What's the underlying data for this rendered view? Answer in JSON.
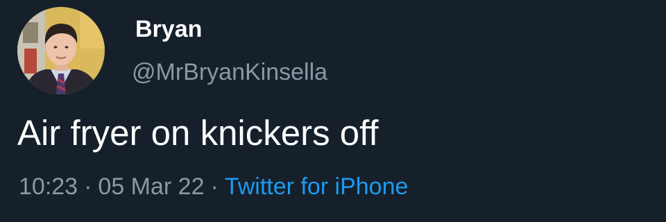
{
  "author": {
    "display_name": "Bryan",
    "handle": "@MrBryanKinsella"
  },
  "tweet": {
    "text": "Air fryer on knickers off",
    "time": "10:23",
    "date": "05 Mar 22",
    "separator": "·",
    "source": "Twitter for iPhone"
  },
  "colors": {
    "background": "#15202b",
    "primary_text": "#ffffff",
    "secondary_text": "#8b98a5",
    "link": "#1d9bf0"
  }
}
